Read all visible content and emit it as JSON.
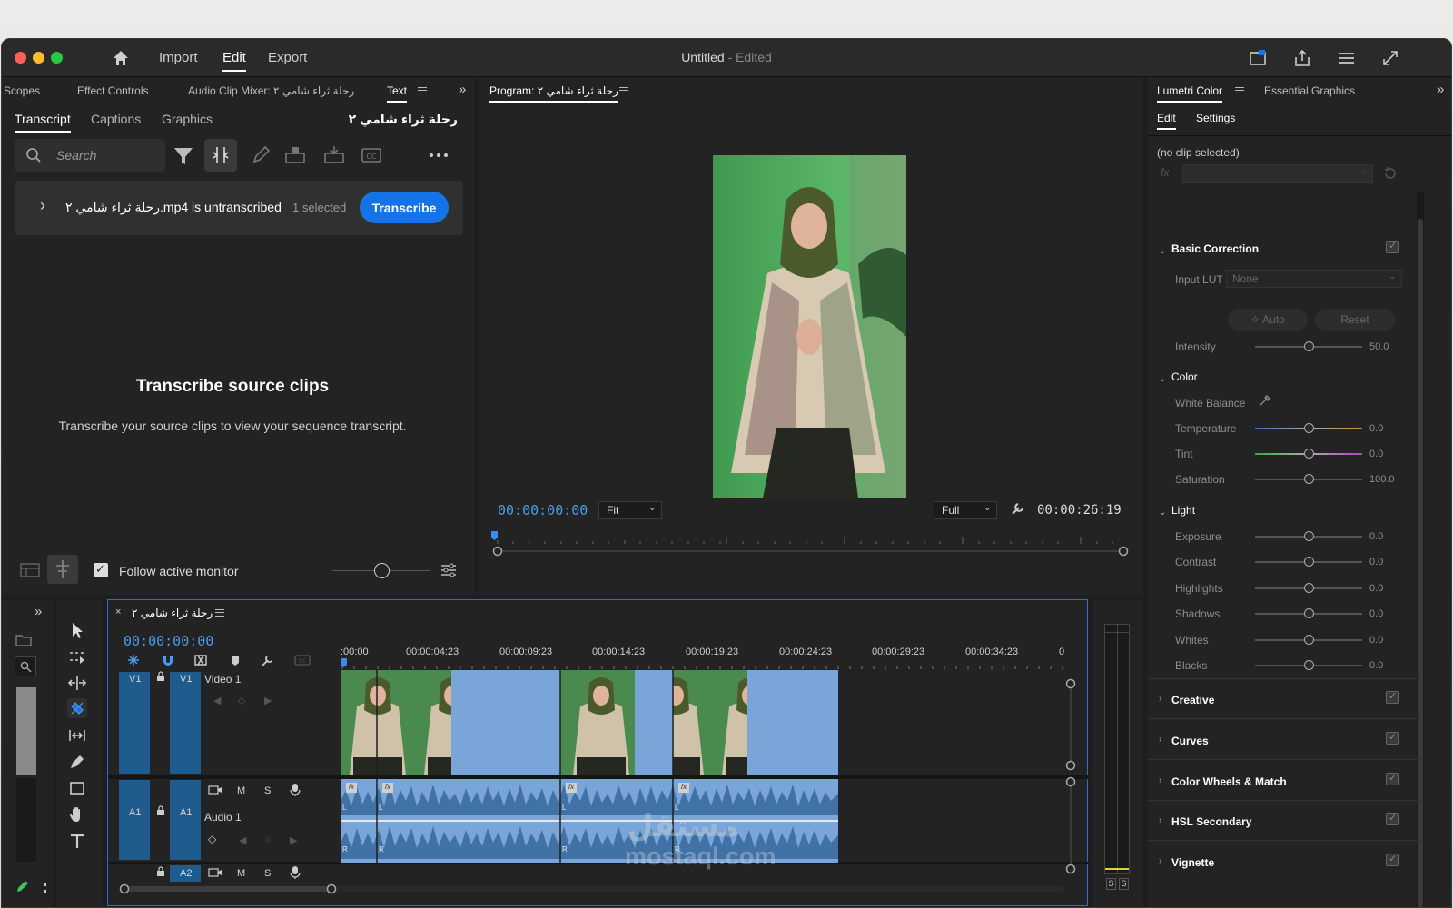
{
  "titlebar": {
    "nav": [
      "Import",
      "Edit",
      "Export"
    ],
    "active": "Edit",
    "title": "Untitled",
    "title_suffix": " - Edited"
  },
  "left_panel": {
    "tabs": [
      "Scopes",
      "Effect Controls",
      "Audio Clip Mixer: رحلة ثراء شامي ٢",
      "Text"
    ],
    "active_tab": "Text",
    "subtabs": [
      "Transcript",
      "Captions",
      "Graphics"
    ],
    "sequence_name": "رحلة ثراء شامي ٢",
    "search_placeholder": "Search",
    "clip_status": "رحلة ثراء شامي ٢.mp4 is untranscribed",
    "selected_count": "1 selected",
    "transcribe_label": "Transcribe",
    "empty_title": "Transcribe source clips",
    "empty_desc": "Transcribe your source clips to view your sequence transcript.",
    "follow_label": "Follow active monitor"
  },
  "program": {
    "title": "Program: رحلة ثراء شامي ٢",
    "timecode": "00:00:00:00",
    "fit": "Fit",
    "quality": "Full",
    "duration": "00:00:26:19"
  },
  "lumetri": {
    "tabs": [
      "Lumetri Color",
      "Essential Graphics"
    ],
    "subtabs": [
      "Edit",
      "Settings"
    ],
    "no_clip": "(no clip selected)",
    "fx": "fx",
    "basic_correction": "Basic Correction",
    "input_lut_label": "Input LUT",
    "input_lut_value": "None",
    "auto": "Auto",
    "reset": "Reset",
    "intensity": {
      "label": "Intensity",
      "value": "50.0"
    },
    "color_section": "Color",
    "white_balance": "White Balance",
    "color_sliders": [
      {
        "label": "Temperature",
        "value": "0.0"
      },
      {
        "label": "Tint",
        "value": "0.0"
      },
      {
        "label": "Saturation",
        "value": "100.0"
      }
    ],
    "light_section": "Light",
    "light_sliders": [
      {
        "label": "Exposure",
        "value": "0.0"
      },
      {
        "label": "Contrast",
        "value": "0.0"
      },
      {
        "label": "Highlights",
        "value": "0.0"
      },
      {
        "label": "Shadows",
        "value": "0.0"
      },
      {
        "label": "Whites",
        "value": "0.0"
      },
      {
        "label": "Blacks",
        "value": "0.0"
      }
    ],
    "sections": [
      "Creative",
      "Curves",
      "Color Wheels & Match",
      "HSL Secondary",
      "Vignette"
    ]
  },
  "timeline": {
    "sequence_name": "رحلة ثراء شامي ٢",
    "timecode": "00:00:00:00",
    "ruler": [
      ":00:00",
      "00:00:04:23",
      "00:00:09:23",
      "00:00:14:23",
      "00:00:19:23",
      "00:00:24:23",
      "00:00:29:23",
      "00:00:34:23",
      "0"
    ],
    "v1_source": "V1",
    "v1_target": "V1",
    "video_track": "Video 1",
    "a1_source": "A1",
    "a1_target": "A1",
    "audio_track": "Audio 1",
    "a2_target": "A2",
    "m": "M",
    "s": "S",
    "audio_marker_l": "L",
    "audio_marker_r": "R",
    "fx_badge": "fx"
  },
  "meter": {
    "s1": "S",
    "s2": "S"
  },
  "watermark": {
    "arabic": "مستقل",
    "latin": "mostaql.com"
  },
  "colors": {
    "accent": "#1473e6",
    "timecode": "#4a9cf0",
    "clip": "#7aa5d8",
    "track": "#205b8e"
  }
}
